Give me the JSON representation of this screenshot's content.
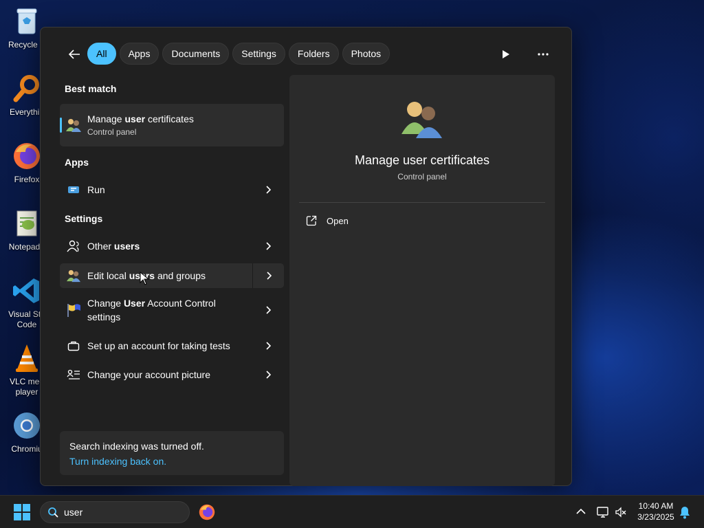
{
  "desktop": {
    "icons": [
      {
        "label": "Recycle B",
        "icon": "recycle-bin-icon"
      },
      {
        "label": "Everythin",
        "icon": "everything-search-icon"
      },
      {
        "label": "Firefox",
        "icon": "firefox-icon"
      },
      {
        "label": "Notepad+",
        "icon": "notepad-plus-plus-icon"
      },
      {
        "label": "Visual Stu",
        "label2": "Code",
        "icon": "vscode-icon"
      },
      {
        "label": "VLC med",
        "label2": "player",
        "icon": "vlc-icon"
      },
      {
        "label": "Chromiu",
        "icon": "chromium-icon"
      }
    ]
  },
  "search": {
    "filters": [
      "All",
      "Apps",
      "Documents",
      "Settings",
      "Folders",
      "Photos"
    ],
    "active_filter": "All",
    "sections": {
      "best_match": "Best match",
      "apps": "Apps",
      "settings": "Settings"
    },
    "best_match": {
      "title_pre": "Manage ",
      "title_hl": "user",
      "title_post": " certificates",
      "subtitle": "Control panel"
    },
    "apps": [
      {
        "label": "Run"
      }
    ],
    "settings": [
      {
        "pre": "Other ",
        "hl": "users",
        "post": ""
      },
      {
        "pre": "Edit local ",
        "hl": "users",
        "post": " and groups"
      },
      {
        "pre": "Change ",
        "hl": "User",
        "post": " Account Control",
        "line2": "settings"
      },
      {
        "pre": "Set up an account for taking tests",
        "hl": "",
        "post": ""
      },
      {
        "pre": "Change your account picture",
        "hl": "",
        "post": ""
      }
    ],
    "indexing": {
      "message": "Search indexing was turned off.",
      "link": "Turn indexing back on."
    },
    "preview": {
      "title": "Manage user certificates",
      "subtitle": "Control panel",
      "action_open": "Open"
    }
  },
  "taskbar": {
    "search_value": "user",
    "clock_time": "10:40 AM",
    "clock_date": "3/23/2025"
  },
  "colors": {
    "accent": "#4cc2ff",
    "panel_bg": "#202020",
    "pane_bg": "#2b2b2b"
  }
}
